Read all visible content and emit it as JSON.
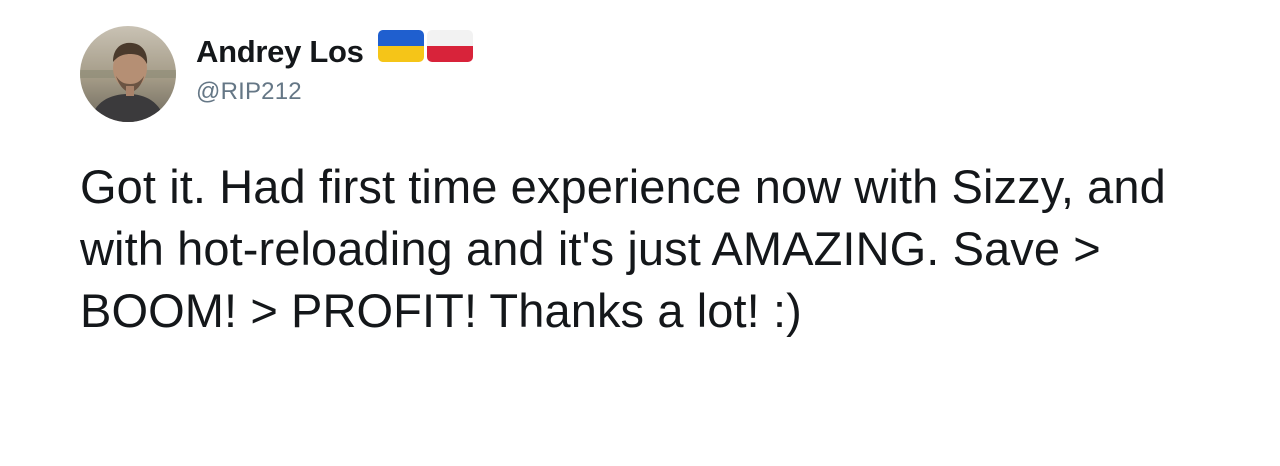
{
  "author": {
    "display_name": "Andrey Los",
    "handle": "@RIP212",
    "flag_emojis": [
      "ukraine-flag-icon",
      "poland-flag-icon"
    ]
  },
  "tweet": {
    "text": "Got it. Had first time experience now with Sizzy, and with hot-reloading and it's just AMAZING. Save > BOOM! > PROFIT! Thanks a lot! :)"
  },
  "colors": {
    "text": "#14171a",
    "handle": "#657786",
    "ukraine_blue": "#1f5fcf",
    "ukraine_yellow": "#f5c518",
    "poland_white": "#f2f2f2",
    "poland_red": "#d8233a"
  }
}
